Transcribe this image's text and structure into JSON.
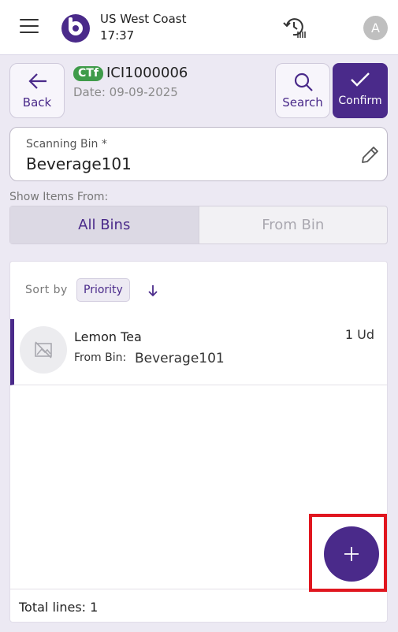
{
  "header": {
    "company": "US West Coast",
    "time": "17:37",
    "avatar_initial": "A",
    "icons": [
      "menu-icon",
      "logo",
      "history-scan-icon",
      "avatar"
    ]
  },
  "toolbar": {
    "back_label": "Back",
    "doc_tag": "CTf",
    "doc_number": "ICI1000006",
    "doc_date": "Date: 09-09-2025",
    "search_label": "Search",
    "confirm_label": "Confirm"
  },
  "scan": {
    "label": "Scanning Bin *",
    "value": "Beverage101"
  },
  "filter": {
    "label": "Show Items From:",
    "options": [
      "All Bins",
      "From Bin"
    ],
    "selected": "All Bins"
  },
  "list": {
    "sort_label": "Sort by",
    "sort_value": "Priority",
    "items": [
      {
        "name": "Lemon Tea",
        "bin_label": "From Bin:",
        "bin": "Beverage101",
        "qty": "1 Ud"
      }
    ],
    "total": "Total lines: 1"
  },
  "colors": {
    "accent": "#4a2a8a",
    "tag": "#3f9b4a",
    "highlight": "#e0161f"
  }
}
